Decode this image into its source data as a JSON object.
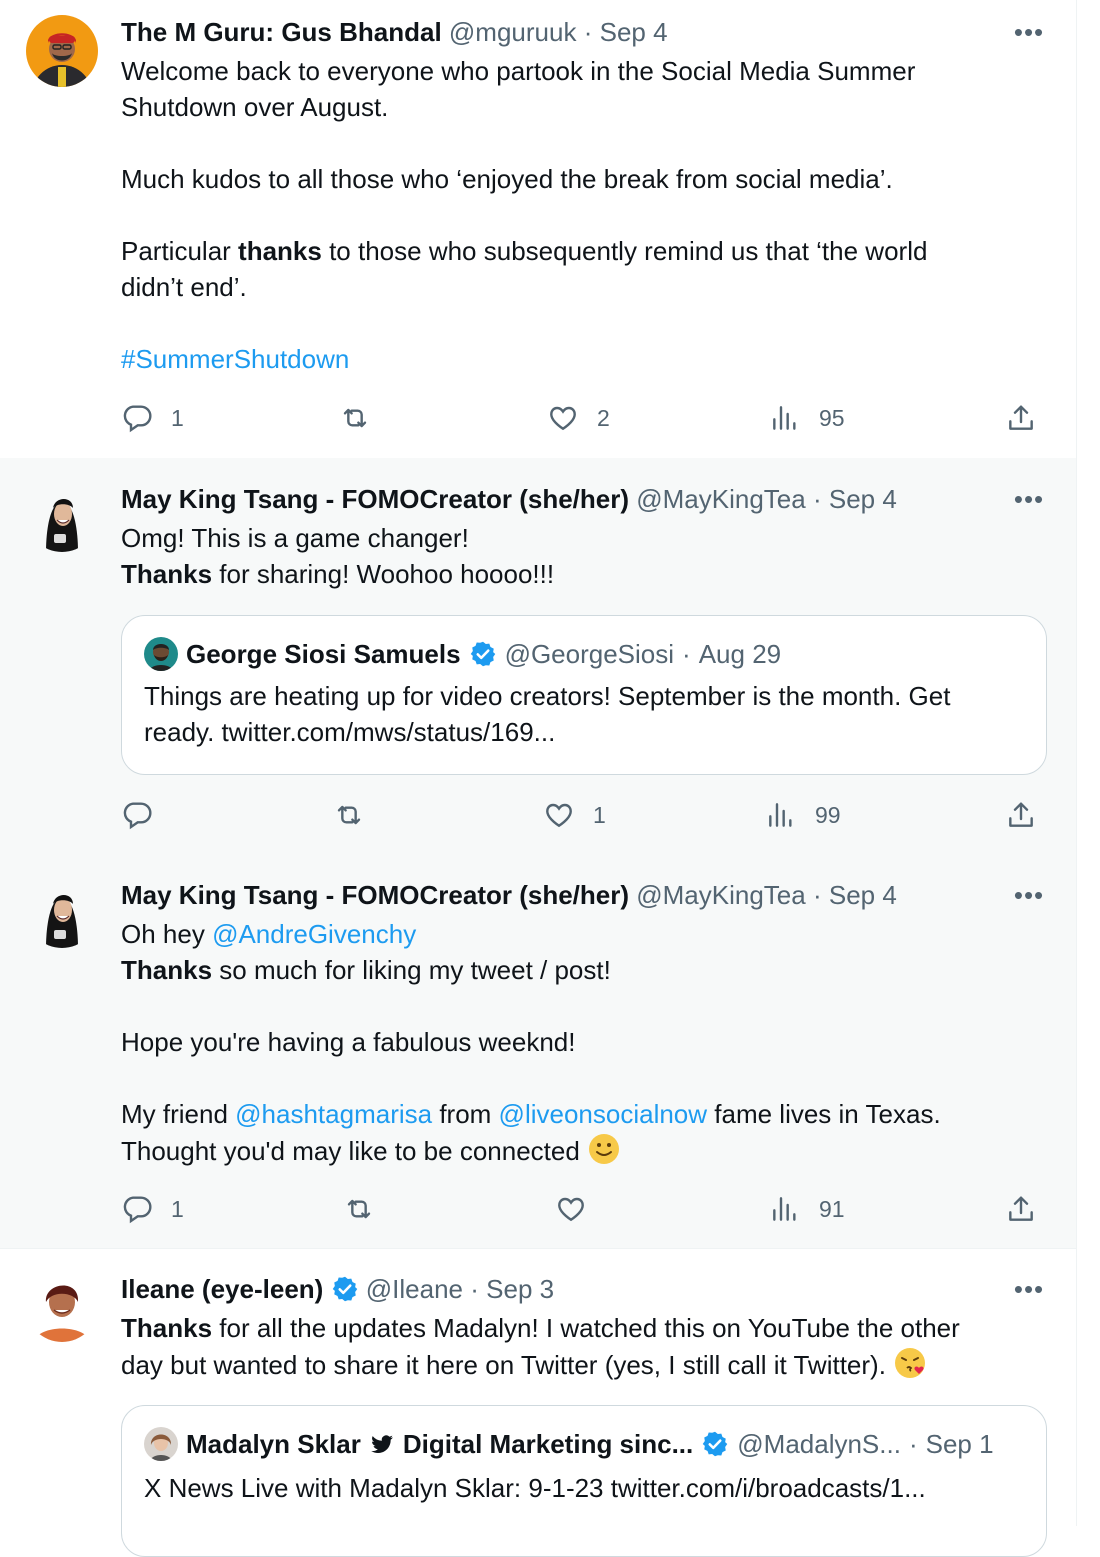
{
  "tweets": [
    {
      "name": "The M Guru: Gus Bhandal",
      "handle": "@mguruuk",
      "dot": "·",
      "date": "Sep 4",
      "text_1": "Welcome back to everyone who partook in the Social Media Summer\nShutdown over August.\n\nMuch kudos to all those who ‘enjoyed the break from social media’.\n\nParticular ",
      "bold_1": "thanks",
      "text_2": " to those who subsequently remind us that ‘the world\ndidn’t end’.\n\n",
      "hashtag": "#SummerShutdown",
      "replies": "1",
      "retweets": "",
      "likes": "2",
      "views": "95"
    },
    {
      "name": "May King Tsang - FOMOCreator (she/her)",
      "handle": "@MayKingTea",
      "dot": "·",
      "date": "Sep 4",
      "text_1": "Omg! This is a game changer!\n",
      "bold_1": "Thanks",
      "text_2": " for sharing! Woohoo hoooo!!!",
      "quote": {
        "name": "George Siosi Samuels",
        "handle": "@GeorgeSiosi",
        "dot": "·",
        "date": "Aug 29",
        "text": "Things are heating up for video creators! September is the month. Get\nready. twitter.com/mws/status/169..."
      },
      "replies": "",
      "retweets": "",
      "likes": "1",
      "views": "99"
    },
    {
      "name": "May King Tsang - FOMOCreator (she/her)",
      "handle": "@MayKingTea",
      "dot": "·",
      "date": "Sep 4",
      "text_1": "Oh hey ",
      "mention_1": "@AndreGivenchy",
      "bold_1": "Thanks",
      "text_2": " so much for liking my tweet / post!\n\nHope you're having a fabulous weeknd!\n\nMy friend ",
      "mention_2": "@hashtagmarisa",
      "text_3": " from ",
      "mention_3": "@liveonsocialnow",
      "text_4": " fame lives in Texas.\nThought you'd may like to be connected ",
      "emoji": "slightly-smiling-face",
      "replies": "1",
      "retweets": "",
      "likes": "",
      "views": "91"
    },
    {
      "name": "Ileane (eye-leen)",
      "handle": "@Ileane",
      "dot": "·",
      "date": "Sep 3",
      "bold_1": "Thanks",
      "text_1": " for all the updates Madalyn! I watched this on YouTube the other\nday but wanted to share it here on Twitter (yes, I still call it Twitter). ",
      "emoji": "face-blowing-a-kiss",
      "quote": {
        "name_1": "Madalyn Sklar",
        "name_2": "Digital Marketing sinc...",
        "handle": "@MadalynS...",
        "dot": "·",
        "date": "Sep 1",
        "text": "X News Live with Madalyn Sklar: 9-1-23 twitter.com/i/broadcasts/1..."
      }
    }
  ],
  "icons": {
    "more": "more-horizontal-icon",
    "reply": "reply-icon",
    "retweet": "retweet-icon",
    "like": "heart-icon",
    "views": "analytics-icon",
    "share": "share-icon",
    "verified": "verified-badge-icon",
    "bird": "bird-icon"
  },
  "colors": {
    "link": "#1d9bf0",
    "secondary_text": "#536471",
    "primary_text": "#0f1419",
    "border": "#eff3f4",
    "alt_bg": "#f7f9f9"
  }
}
